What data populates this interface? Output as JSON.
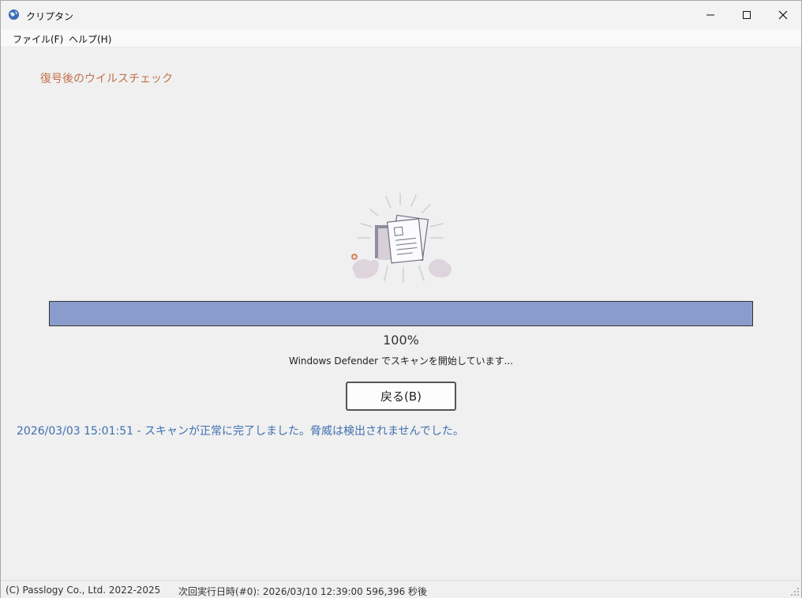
{
  "window": {
    "title": "クリプタン",
    "icon": "globe-app-icon"
  },
  "menu": {
    "file": "ファイル(F)",
    "help": "ヘルプ(H)"
  },
  "main": {
    "heading": "復号後のウイルスチェック",
    "progress_percent": 100,
    "progress_label": "100%",
    "status_text": "Windows Defender でスキャンを開始しています...",
    "back_button": "戻る(B)",
    "log_line": "2026/03/03 15:01:51 - スキャンが正常に完了しました。脅威は検出されませんでした。"
  },
  "statusbar": {
    "copyright": "(C) Passlogy Co., Ltd. 2022-2025",
    "next_run": "次回実行日時(#0): 2026/03/10 12:39:00  596,396  秒後"
  },
  "colors": {
    "heading": "#c0714a",
    "progress_fill": "#8a9ccc",
    "log_text": "#3f6fb0"
  }
}
